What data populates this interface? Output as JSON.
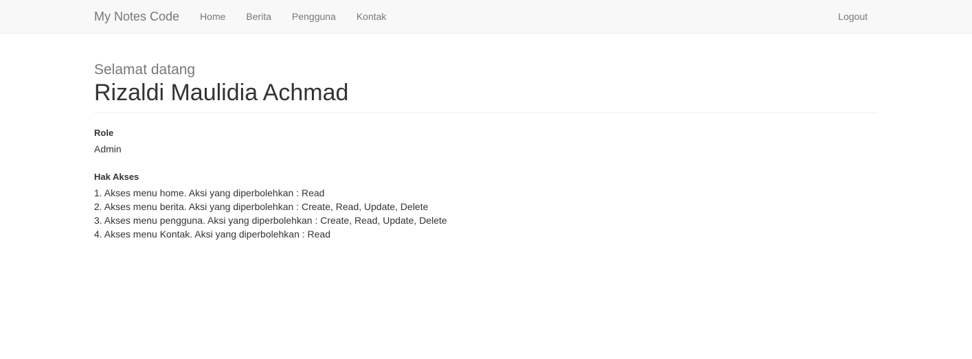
{
  "navbar": {
    "brand": "My Notes Code",
    "items": [
      {
        "label": "Home",
        "name": "nav-item-home"
      },
      {
        "label": "Berita",
        "name": "nav-item-berita"
      },
      {
        "label": "Pengguna",
        "name": "nav-item-pengguna"
      },
      {
        "label": "Kontak",
        "name": "nav-item-kontak"
      }
    ],
    "logout_label": "Logout"
  },
  "page_header": {
    "welcome": "Selamat datang",
    "user_name": "Rizaldi Maulidia Achmad"
  },
  "role_section": {
    "label": "Role",
    "value": "Admin"
  },
  "access_section": {
    "label": "Hak Akses",
    "items": [
      "1. Akses menu home. Aksi yang diperbolehkan : Read",
      "2. Akses menu berita. Aksi yang diperbolehkan : Create, Read, Update, Delete",
      "3. Akses menu pengguna. Aksi yang diperbolehkan : Create, Read, Update, Delete",
      "4. Akses menu Kontak. Aksi yang diperbolehkan : Read"
    ]
  },
  "colors": {
    "navbar_background": "#f8f8f8",
    "navbar_border": "#e7e7e7",
    "muted_text": "#777777",
    "body_text": "#333333",
    "divider": "#eeeeee",
    "page_background": "#ffffff"
  }
}
